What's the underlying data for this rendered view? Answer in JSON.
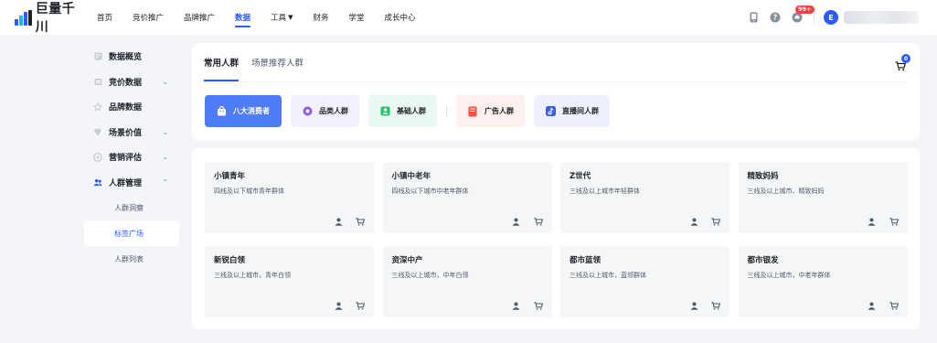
{
  "brand": {
    "name": "巨量千川"
  },
  "nav": {
    "items": [
      {
        "label": "首页"
      },
      {
        "label": "竞价推广"
      },
      {
        "label": "品牌推广"
      },
      {
        "label": "数据"
      },
      {
        "label": "工具"
      },
      {
        "label": "财务"
      },
      {
        "label": "学堂"
      },
      {
        "label": "成长中心"
      }
    ],
    "active": "数据"
  },
  "topright": {
    "notification_count": "99+",
    "avatar_letter": "E"
  },
  "sidebar": {
    "items": [
      {
        "label": "数据概览",
        "icon": "overview-icon"
      },
      {
        "label": "竞价数据",
        "icon": "bid-data-icon"
      },
      {
        "label": "品牌数据",
        "icon": "brand-data-icon"
      },
      {
        "label": "场景价值",
        "icon": "scene-value-icon"
      },
      {
        "label": "营销评估",
        "icon": "marketing-eval-icon"
      },
      {
        "label": "人群管理",
        "icon": "audience-icon"
      }
    ],
    "subitems": [
      {
        "label": "人群洞察"
      },
      {
        "label": "标签广场"
      },
      {
        "label": "人群列表"
      }
    ]
  },
  "tabs": [
    {
      "label": "常用人群"
    },
    {
      "label": "场景推荐人群"
    }
  ],
  "cart": {
    "count": "0"
  },
  "chips": [
    {
      "label": "八大消费者",
      "icon": "bag-icon"
    },
    {
      "label": "品类人群",
      "icon": "category-icon"
    },
    {
      "label": "基础人群",
      "icon": "basic-audience-icon"
    },
    {
      "label": "广告人群",
      "icon": "ad-audience-icon"
    },
    {
      "label": "直播间人群",
      "icon": "tiktok-icon"
    }
  ],
  "cards": [
    {
      "title": "小镇青年",
      "desc": "四线及以下城市青年群体"
    },
    {
      "title": "小镇中老年",
      "desc": "四线及以下城市中老年群体"
    },
    {
      "title": "Z世代",
      "desc": "三线及以上城市年轻群体"
    },
    {
      "title": "精致妈妈",
      "desc": "三线及以上城市、精致妈妈"
    },
    {
      "title": "新锐白领",
      "desc": "三线及以上城市，青年白领"
    },
    {
      "title": "资深中产",
      "desc": "三线及以上城市，中年白领"
    },
    {
      "title": "都市蓝领",
      "desc": "三线及以上城市，蓝领群体"
    },
    {
      "title": "都市银发",
      "desc": "三线及以上城市，中老年群体"
    }
  ],
  "colors": {
    "accent": "#2b5bff",
    "chip_active": "#4e7bf6",
    "badge": "#f53f3f"
  }
}
